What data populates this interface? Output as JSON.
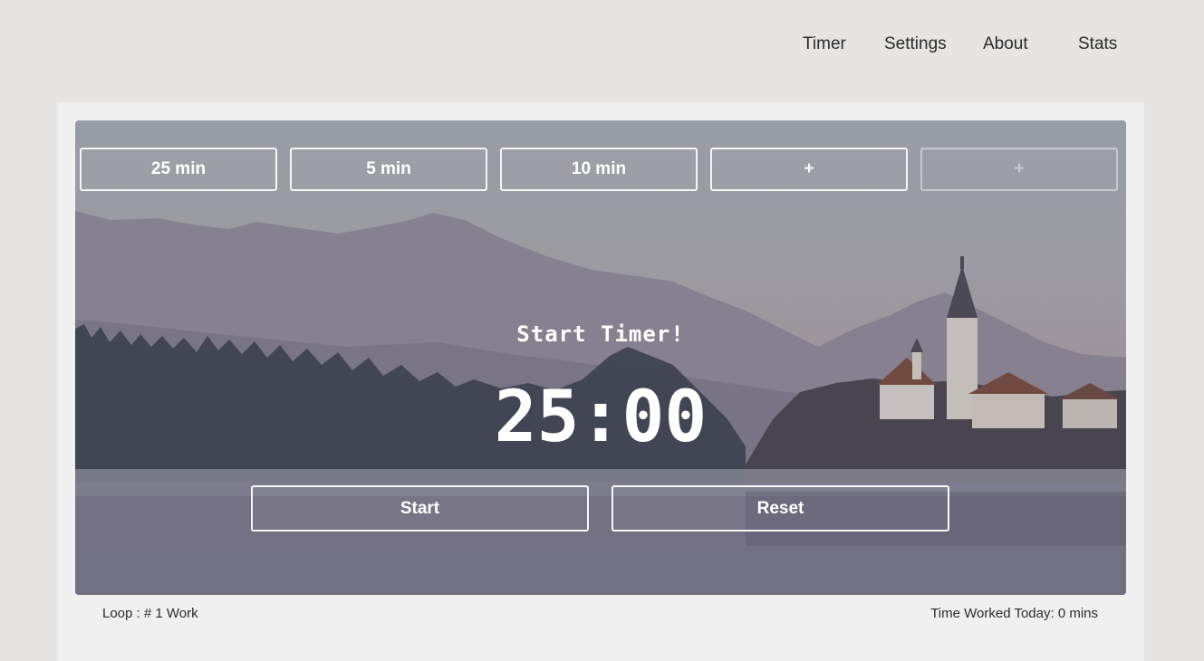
{
  "nav": {
    "items": [
      {
        "label": "Timer"
      },
      {
        "label": "Settings"
      },
      {
        "label": "About"
      },
      {
        "label": "Stats"
      }
    ]
  },
  "presets": [
    {
      "label": "25 min",
      "enabled": true
    },
    {
      "label": "5 min",
      "enabled": true
    },
    {
      "label": "10 min",
      "enabled": true
    },
    {
      "label": "+",
      "enabled": true
    },
    {
      "label": "+",
      "enabled": false
    }
  ],
  "timer": {
    "status": "Start Timer!",
    "display": "25:00"
  },
  "controls": {
    "start_label": "Start",
    "reset_label": "Reset"
  },
  "footer": {
    "loop": "Loop : # 1 Work",
    "time_worked": "Time Worked Today: 0 mins"
  },
  "background": {
    "description_icon": "lake-castle-landscape-image"
  }
}
